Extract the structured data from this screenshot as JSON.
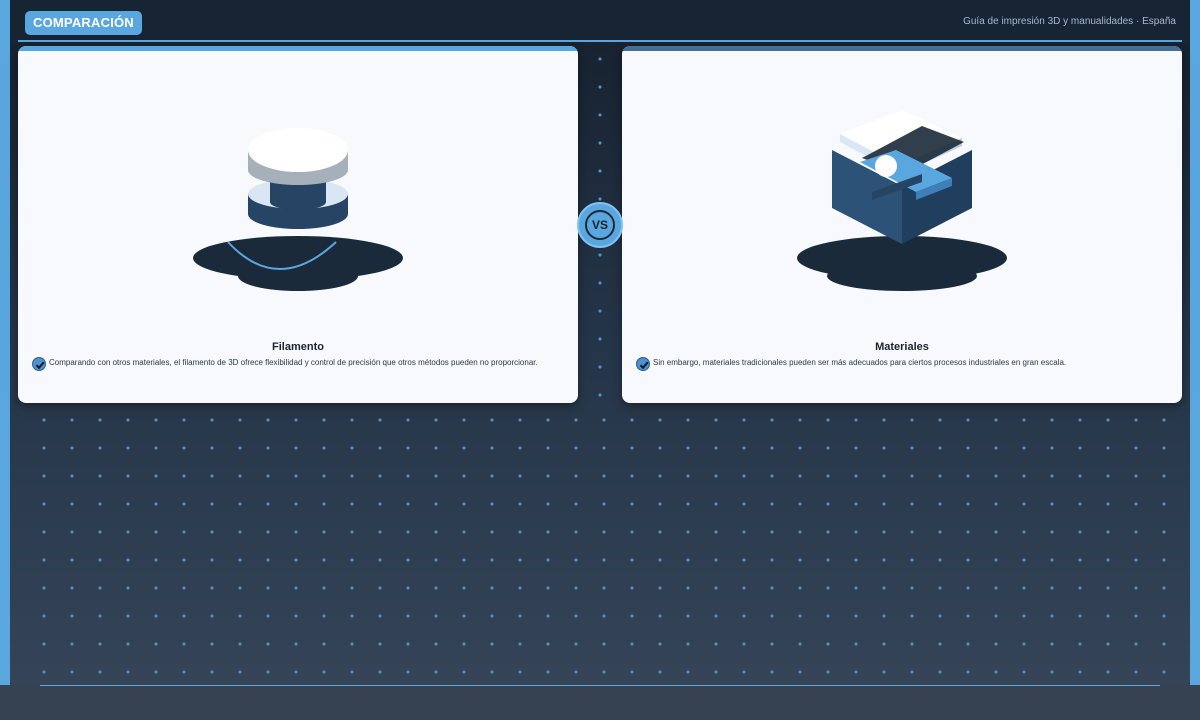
{
  "header": {
    "badge": "COMPARACIÓN",
    "subtitle": "Guía de impresión 3D y manualidades · España"
  },
  "vs_label": "VS",
  "cards": [
    {
      "title": "Filamento",
      "text": "Comparando con otros materiales, el filamento de 3D ofrece flexibilidad y control de precisión que otros métodos pueden no proporcionar.",
      "icon": "filament-spool-icon"
    },
    {
      "title": "Materiales",
      "text": "Sin embargo, materiales tradicionales pueden ser más adecuados para ciertos procesos industriales en gran escala.",
      "icon": "material-block-icon"
    }
  ],
  "colors": {
    "accent": "#5aa7df",
    "dark": "#1b2a3a",
    "card": "#f7f9fc",
    "deep_blue": "#2c5278"
  }
}
